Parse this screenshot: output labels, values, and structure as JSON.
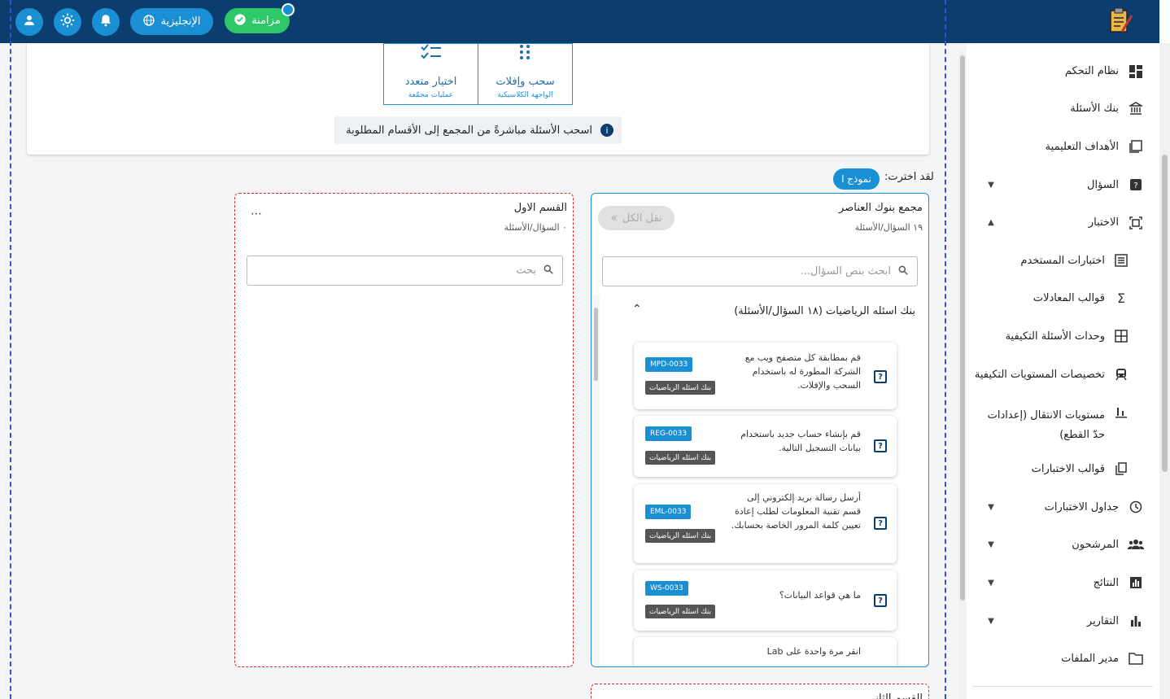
{
  "topbar": {
    "sync_label": "مزامنة",
    "language_label": "الإنجليزية"
  },
  "top_card": {
    "modes": [
      {
        "title": "سحب وإفلات",
        "subtitle": "الواجهة الكلاسيكية"
      },
      {
        "title": "اختيار متعدد",
        "subtitle": "عمليات مجمّعة"
      }
    ],
    "info_text": "اسحب الأسئلة مباشرةً من المجمع إلى الأقسام المطلوبة"
  },
  "selection": {
    "label": "لقد اخترت:",
    "chip": "نموذج ا"
  },
  "pool": {
    "title": "مجمع بنوك العناصر",
    "count": "١٩ السؤال/الأسئلة",
    "move_all_label": "نقل الكل",
    "search_placeholder": "ابحث بنص السؤال...",
    "bank_header": "بنك اسئله الرياضيات (١٨ السؤال/الأسئلة)",
    "questions": [
      {
        "text": "قم بمطابقة كل متصفح ويب مع الشركة المطورة له باستخدام السحب والإفلات.",
        "code": "MPD-0033",
        "bank": "بنك اسئله الرياضيات"
      },
      {
        "text": "قم بإنشاء حساب جديد باستخدام بيانات التسجيل التالية.",
        "code": "REG-0033",
        "bank": "بنك اسئله الرياضيات"
      },
      {
        "text": "أرسل رسالة بريد إلكتروني إلى قسم تقنية المعلومات لطلب إعادة تعيين كلمة المرور الخاصة بحسابك.",
        "code": "EML-0033",
        "bank": "بنك اسئله الرياضيات"
      },
      {
        "text": "ما هي قواعد البيانات؟",
        "code": "WS-0033",
        "bank": "بنك اسئله الرياضيات"
      },
      {
        "text": "انقر مرة واحدة على Lab",
        "code": "",
        "bank": ""
      }
    ]
  },
  "section1": {
    "title": "القسم الاول",
    "count": "٠ السؤال/الأسئلة",
    "search_placeholder": "بحث",
    "more_label": "⋯"
  },
  "section2": {
    "title": "القسم الثاني"
  },
  "sidebar": {
    "items": [
      {
        "label": "نظام التحكم",
        "icon": "dashboard-icon"
      },
      {
        "label": "بنك الأسئلة",
        "icon": "bank-icon"
      },
      {
        "label": "الأهداف التعليمية",
        "icon": "book-icon"
      },
      {
        "label": "السؤال",
        "icon": "question-icon"
      },
      {
        "label": "الاختبار",
        "icon": "exam-icon"
      },
      {
        "label": "اختبارات المستخدم",
        "icon": "list-icon"
      },
      {
        "label": "قوالب المعادلات",
        "icon": "sigma-icon"
      },
      {
        "label": "وحدات الأسئلة التكيفية",
        "icon": "grid-icon"
      },
      {
        "label": "تخصيصات المستويات التكيفية",
        "icon": "train-icon"
      },
      {
        "label": "مستويات الانتقال (إعدادات حدّ القطع)",
        "icon": "bar-icon"
      },
      {
        "label": "قوالب الاختبارات",
        "icon": "copy-icon"
      },
      {
        "label": "جداول الاختبارات",
        "icon": "clock-icon"
      },
      {
        "label": "المرشحون",
        "icon": "people-icon"
      },
      {
        "label": "النتائج",
        "icon": "chart-box-icon"
      },
      {
        "label": "التقارير",
        "icon": "bar-chart-icon"
      },
      {
        "label": "مدير الملفات",
        "icon": "folder-icon"
      }
    ]
  }
}
